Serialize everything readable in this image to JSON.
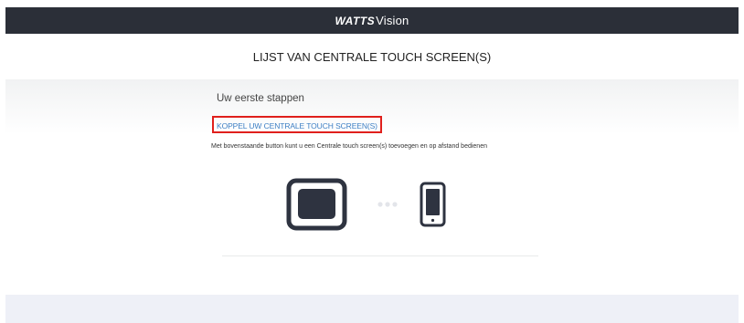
{
  "header": {
    "brand_strong": "WATTS",
    "brand_light": "Vision",
    "background": "#2b2f38"
  },
  "title": {
    "text": "LIJST VAN CENTRALE TOUCH SCREEN(S)"
  },
  "onboarding": {
    "heading": "Uw eerste stappen",
    "link_label": "KOPPEL UW CENTRALE TOUCH SCREEN(S)",
    "description": "Met bovenstaande button kunt u een Centrale touch screen(s) toevoegen en op afstand bedienen",
    "link_color": "#3d7fc4",
    "highlight_color": "#e0201c"
  },
  "illustration": {
    "left_icon": "central-touch-screen-icon",
    "middle_icon": "connection-dots-icon",
    "right_icon": "smartphone-icon"
  }
}
